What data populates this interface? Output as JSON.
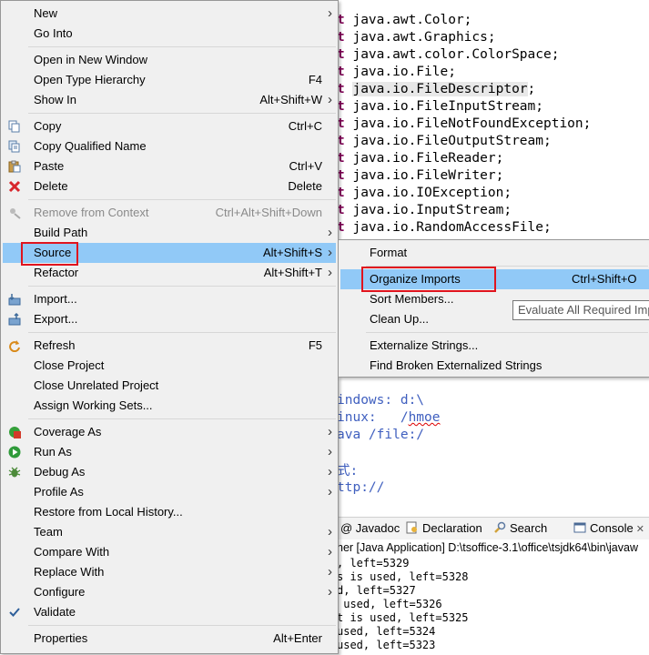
{
  "editor": {
    "imports": [
      "java.awt.Color;",
      "java.awt.Graphics;",
      "java.awt.color.ColorSpace;",
      "java.io.File;",
      "java.io.FileDescriptor;",
      "java.io.FileInputStream;",
      "java.io.FileNotFoundException;",
      "java.io.FileOutputStream;",
      "java.io.FileReader;",
      "java.io.FileWriter;",
      "java.io.IOException;",
      "java.io.InputStream;",
      "java.io.RandomAccessFile;"
    ],
    "import_keyword_tail": "t",
    "comments": [
      "indows: d:\\",
      "inux:   /hmoe",
      "ava /file:/",
      "",
      "式:",
      "ttp://"
    ]
  },
  "views": {
    "tabs": [
      {
        "label": "@ Javadoc",
        "icon": "javadoc-icon"
      },
      {
        "label": "Declaration",
        "icon": "declaration-icon"
      },
      {
        "label": "Search",
        "icon": "search-icon"
      },
      {
        "label": "Console",
        "icon": "console-icon",
        "close": "✕"
      }
    ],
    "console_title": "her [Java Application] D:\\tsoffice-3.1\\office\\tsjdk64\\bin\\javaw",
    "console_lines": [
      ", left=5329",
      "s is used, left=5328",
      "d, left=5327",
      " used, left=5326",
      "t is used, left=5325",
      "used, left=5324",
      "used, left=5323"
    ]
  },
  "context_menu": {
    "items": [
      {
        "label": "New",
        "submenu": true
      },
      {
        "label": "Go Into"
      },
      {
        "sep": true
      },
      {
        "label": "Open in New Window"
      },
      {
        "label": "Open Type Hierarchy",
        "accel": "F4"
      },
      {
        "label": "Show In",
        "accel": "Alt+Shift+W",
        "submenu": true
      },
      {
        "sep": true
      },
      {
        "label": "Copy",
        "accel": "Ctrl+C",
        "icon": "copy-icon"
      },
      {
        "label": "Copy Qualified Name",
        "icon": "copy-qualified-name-icon"
      },
      {
        "label": "Paste",
        "accel": "Ctrl+V",
        "icon": "paste-icon"
      },
      {
        "label": "Delete",
        "accel": "Delete",
        "icon": "delete-icon"
      },
      {
        "sep": true
      },
      {
        "label": "Remove from Context",
        "accel": "Ctrl+Alt+Shift+Down",
        "icon": "remove-from-context-icon",
        "disabled": true
      },
      {
        "label": "Build Path",
        "submenu": true
      },
      {
        "label": "Source",
        "accel": "Alt+Shift+S",
        "submenu": true,
        "selected": true
      },
      {
        "label": "Refactor",
        "accel": "Alt+Shift+T",
        "submenu": true
      },
      {
        "sep": true
      },
      {
        "label": "Import...",
        "icon": "import-icon"
      },
      {
        "label": "Export...",
        "icon": "export-icon"
      },
      {
        "sep": true
      },
      {
        "label": "Refresh",
        "accel": "F5",
        "icon": "refresh-icon"
      },
      {
        "label": "Close Project"
      },
      {
        "label": "Close Unrelated Project"
      },
      {
        "label": "Assign Working Sets..."
      },
      {
        "sep": true
      },
      {
        "label": "Coverage As",
        "submenu": true,
        "icon": "coverage-icon"
      },
      {
        "label": "Run As",
        "submenu": true,
        "icon": "run-icon"
      },
      {
        "label": "Debug As",
        "submenu": true,
        "icon": "debug-icon"
      },
      {
        "label": "Profile As",
        "submenu": true
      },
      {
        "label": "Restore from Local History..."
      },
      {
        "label": "Team",
        "submenu": true
      },
      {
        "label": "Compare With",
        "submenu": true
      },
      {
        "label": "Replace With",
        "submenu": true
      },
      {
        "label": "Configure",
        "submenu": true
      },
      {
        "label": "Validate",
        "icon": "checkmark-icon"
      },
      {
        "sep": true
      },
      {
        "label": "Properties",
        "accel": "Alt+Enter"
      }
    ]
  },
  "source_submenu": {
    "items": [
      {
        "label": "Format"
      },
      {
        "sep": true
      },
      {
        "label": "Organize Imports",
        "accel": "Ctrl+Shift+O",
        "selected": true
      },
      {
        "label": "Sort Members..."
      },
      {
        "label": "Clean Up..."
      },
      {
        "sep": true
      },
      {
        "label": "Externalize Strings..."
      },
      {
        "label": "Find Broken Externalized Strings"
      }
    ]
  },
  "tooltip": "Evaluate All Required Imports",
  "colors": {
    "keyword": "#7f0055",
    "comment": "#3f5fbf",
    "menu_bg": "#f0f0f0",
    "menu_highlight": "#91c9f7",
    "annotation_red": "#e0141e"
  }
}
